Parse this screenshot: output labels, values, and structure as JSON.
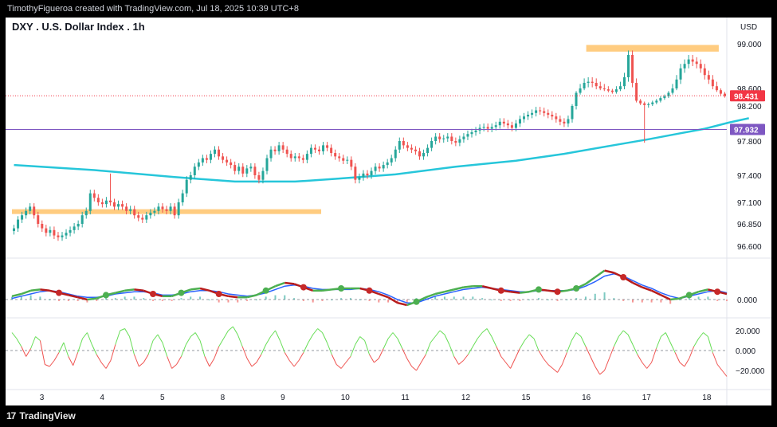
{
  "header": {
    "credit": "TimothyFigueroa created with TradingView.com, Jul 18, 2025 10:39 UTC+8"
  },
  "symbol": {
    "title": "DXY . U.S. Dollar Index . 1h"
  },
  "footer": {
    "brand": "TradingView",
    "brand_mark": "17"
  },
  "chart_data": {
    "type": "candlestick",
    "currency": "USD",
    "last_price": {
      "label": "98.431",
      "value": 98.431,
      "color": "#f23645"
    },
    "reference_line": {
      "label": "97.932",
      "value": 97.932,
      "color": "#7e57c2"
    },
    "moving_average": {
      "color": "#26c6da",
      "points": [
        [
          0,
          97.52
        ],
        [
          20,
          97.46
        ],
        [
          40,
          97.38
        ],
        [
          55,
          97.33
        ],
        [
          70,
          97.33
        ],
        [
          80,
          97.36
        ],
        [
          95,
          97.41
        ],
        [
          110,
          97.5
        ],
        [
          125,
          97.57
        ],
        [
          137,
          97.65
        ],
        [
          148,
          97.74
        ],
        [
          158,
          97.82
        ],
        [
          165,
          97.88
        ],
        [
          172,
          97.94
        ],
        [
          178,
          98.01
        ],
        [
          183,
          98.06
        ]
      ]
    },
    "price_axis": {
      "ticks": [
        "99.000",
        "98.600",
        "98.200",
        "97.800",
        "97.400",
        "97.100",
        "96.850",
        "96.600"
      ],
      "tick_values": [
        99.0,
        98.6,
        98.2,
        97.8,
        97.4,
        97.1,
        96.85,
        96.6
      ]
    },
    "time_axis": {
      "labels": [
        "3",
        "4",
        "5",
        "8",
        "9",
        "10",
        "11",
        "12",
        "15",
        "16",
        "17",
        "18"
      ],
      "bar_index": [
        7,
        22,
        37,
        52,
        67,
        82,
        97,
        112,
        127,
        142,
        157,
        172
      ]
    },
    "zones": [
      {
        "bar_from": 0,
        "bar_to": 76,
        "low": 96.98,
        "high": 97.02,
        "color": "#ffcc80"
      },
      {
        "bar_from": 143,
        "bar_to": 175,
        "low": 98.93,
        "high": 98.99,
        "color": "#ffcc80"
      }
    ],
    "close": [
      96.8,
      96.9,
      96.95,
      97.0,
      97.05,
      96.95,
      96.85,
      96.8,
      96.75,
      96.78,
      96.72,
      96.7,
      96.72,
      96.75,
      96.78,
      96.82,
      96.85,
      96.95,
      97.0,
      97.2,
      97.15,
      97.1,
      97.08,
      97.12,
      97.1,
      97.05,
      97.08,
      97.05,
      97.0,
      97.02,
      96.95,
      96.92,
      96.9,
      96.95,
      96.98,
      97.0,
      97.05,
      97.02,
      97.0,
      97.05,
      96.95,
      97.1,
      97.2,
      97.35,
      97.4,
      97.5,
      97.55,
      97.6,
      97.58,
      97.65,
      97.7,
      97.62,
      97.58,
      97.55,
      97.52,
      97.45,
      97.5,
      97.42,
      97.48,
      97.5,
      97.4,
      97.35,
      97.45,
      97.6,
      97.7,
      97.68,
      97.75,
      97.7,
      97.65,
      97.6,
      97.62,
      97.6,
      97.58,
      97.65,
      97.72,
      97.7,
      97.68,
      97.75,
      97.72,
      97.66,
      97.62,
      97.6,
      97.57,
      97.58,
      97.5,
      97.35,
      97.38,
      97.42,
      97.4,
      97.45,
      97.5,
      97.48,
      97.52,
      97.55,
      97.6,
      97.7,
      97.8,
      97.75,
      97.72,
      97.7,
      97.68,
      97.62,
      97.66,
      97.72,
      97.8,
      97.85,
      97.82,
      97.83,
      97.85,
      97.8,
      97.78,
      97.82,
      97.85,
      97.88,
      97.9,
      97.92,
      97.95,
      97.96,
      97.94,
      97.96,
      97.98,
      98.02,
      98.0,
      97.98,
      97.95,
      98.0,
      98.05,
      98.08,
      98.1,
      98.12,
      98.15,
      98.14,
      98.12,
      98.1,
      98.08,
      98.05,
      98.02,
      98.0,
      98.05,
      98.2,
      98.5,
      98.6,
      98.65,
      98.66,
      98.65,
      98.62,
      98.6,
      98.58,
      98.55,
      98.52,
      98.58,
      98.62,
      98.7,
      98.9,
      98.65,
      98.32,
      98.26,
      98.22,
      98.24,
      98.28,
      98.32,
      98.38,
      98.42,
      98.5,
      98.6,
      98.68,
      98.78,
      98.82,
      98.86,
      98.84,
      98.82,
      98.78,
      98.72,
      98.68,
      98.62,
      98.56,
      98.48,
      98.43
    ],
    "spikes": [
      {
        "bar": 24,
        "high": 97.42
      },
      {
        "bar": 157,
        "low": 97.78
      }
    ],
    "oscillator1": {
      "fast": [
        0.3,
        0.5,
        0.8,
        0.9,
        0.8,
        0.6,
        0.4,
        0.2,
        0.0,
        0.1,
        0.4,
        0.6,
        0.8,
        0.9,
        0.8,
        0.5,
        0.3,
        0.3,
        0.6,
        0.9,
        1.0,
        0.8,
        0.5,
        0.3,
        0.2,
        0.2,
        0.4,
        0.8,
        1.2,
        1.5,
        1.4,
        1.1,
        0.8,
        0.8,
        0.9,
        1.0,
        1.0,
        1.0,
        0.8,
        0.5,
        0.2,
        -0.3,
        -0.5,
        -0.2,
        0.2,
        0.5,
        0.7,
        0.9,
        1.1,
        1.2,
        1.2,
        1.0,
        0.8,
        0.7,
        0.6,
        0.7,
        0.9,
        0.8,
        0.7,
        0.8,
        1.0,
        1.4,
        2.0,
        2.6,
        2.4,
        2.0,
        1.5,
        1.1,
        0.8,
        0.4,
        0.0,
        0.1,
        0.4,
        0.7,
        0.9,
        0.7,
        0.5
      ],
      "slow": [
        0.1,
        0.3,
        0.5,
        0.7,
        0.8,
        0.7,
        0.5,
        0.3,
        0.2,
        0.2,
        0.3,
        0.5,
        0.6,
        0.7,
        0.7,
        0.6,
        0.4,
        0.4,
        0.5,
        0.7,
        0.8,
        0.8,
        0.7,
        0.5,
        0.4,
        0.3,
        0.4,
        0.6,
        0.9,
        1.2,
        1.3,
        1.2,
        1.0,
        0.9,
        0.9,
        0.9,
        0.9,
        1.0,
        0.9,
        0.7,
        0.4,
        0.0,
        -0.3,
        -0.3,
        0.0,
        0.3,
        0.5,
        0.7,
        0.9,
        1.0,
        1.1,
        1.0,
        0.9,
        0.8,
        0.7,
        0.7,
        0.8,
        0.8,
        0.8,
        0.8,
        0.9,
        1.2,
        1.6,
        2.1,
        2.3,
        2.1,
        1.7,
        1.3,
        1.0,
        0.6,
        0.3,
        0.1,
        0.3,
        0.5,
        0.7,
        0.8,
        0.6
      ],
      "zero_label": "0.000",
      "up_color": "#4caf50",
      "down_color": "#b71c1c",
      "line_color": "#2962ff"
    },
    "oscillator2": {
      "ticks": [
        "20.000",
        "0.000",
        "−20.000"
      ],
      "tick_values": [
        20,
        0,
        -20
      ],
      "values": [
        18,
        12,
        4,
        -6,
        2,
        14,
        10,
        -14,
        -16,
        -10,
        -2,
        8,
        -6,
        -15,
        -2,
        12,
        18,
        6,
        -4,
        -12,
        -18,
        -10,
        6,
        20,
        22,
        14,
        -4,
        -16,
        -12,
        -4,
        10,
        16,
        8,
        -6,
        -18,
        -14,
        -6,
        6,
        14,
        18,
        10,
        -6,
        -16,
        -8,
        4,
        12,
        20,
        24,
        16,
        4,
        -8,
        -16,
        -12,
        -4,
        6,
        14,
        20,
        10,
        -2,
        -10,
        -16,
        -10,
        -2,
        8,
        16,
        22,
        18,
        8,
        -4,
        -14,
        -18,
        -12,
        -6,
        6,
        14,
        10,
        -4,
        -12,
        -8,
        2,
        12,
        18,
        12,
        2,
        -8,
        -16,
        -20,
        -12,
        -4,
        8,
        14,
        20,
        16,
        6,
        -6,
        -14,
        -10,
        -4,
        4,
        12,
        18,
        22,
        14,
        4,
        -6,
        -12,
        -18,
        -8,
        2,
        10,
        16,
        12,
        0,
        -8,
        -14,
        -18,
        -22,
        -14,
        -2,
        10,
        18,
        14,
        4,
        -6,
        -16,
        -24,
        -20,
        -8,
        4,
        14,
        20,
        16,
        6,
        -4,
        -12,
        -18,
        -12,
        2,
        14,
        18,
        8,
        -2,
        -12,
        -16,
        -8,
        4,
        12,
        18,
        14,
        -2,
        -14,
        -20,
        -26
      ]
    }
  }
}
